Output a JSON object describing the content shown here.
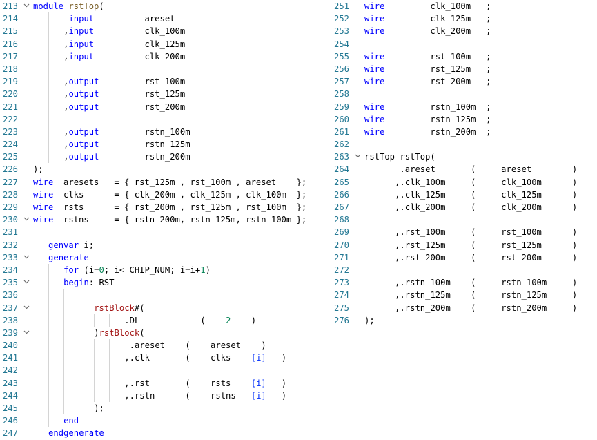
{
  "left_pane": {
    "lines": [
      {
        "n": "213",
        "fold": true,
        "indent": 0,
        "tokens": [
          [
            "keyword",
            "module "
          ],
          [
            "module",
            "rstTop"
          ],
          [
            "plain",
            "("
          ]
        ]
      },
      {
        "n": "214",
        "fold": false,
        "indent": 2,
        "tokens": [
          [
            "plain",
            " "
          ],
          [
            "keyword",
            "input"
          ],
          [
            "plain",
            "          areset"
          ]
        ]
      },
      {
        "n": "215",
        "fold": false,
        "indent": 2,
        "tokens": [
          [
            "plain",
            ","
          ],
          [
            "keyword",
            "input"
          ],
          [
            "plain",
            "          clk_100m"
          ]
        ]
      },
      {
        "n": "216",
        "fold": false,
        "indent": 2,
        "tokens": [
          [
            "plain",
            ","
          ],
          [
            "keyword",
            "input"
          ],
          [
            "plain",
            "          clk_125m"
          ]
        ]
      },
      {
        "n": "217",
        "fold": false,
        "indent": 2,
        "tokens": [
          [
            "plain",
            ","
          ],
          [
            "keyword",
            "input"
          ],
          [
            "plain",
            "          clk_200m"
          ]
        ]
      },
      {
        "n": "218",
        "fold": false,
        "indent": 2,
        "tokens": []
      },
      {
        "n": "219",
        "fold": false,
        "indent": 2,
        "tokens": [
          [
            "plain",
            ","
          ],
          [
            "keyword",
            "output"
          ],
          [
            "plain",
            "         rst_100m"
          ]
        ]
      },
      {
        "n": "220",
        "fold": false,
        "indent": 2,
        "tokens": [
          [
            "plain",
            ","
          ],
          [
            "keyword",
            "output"
          ],
          [
            "plain",
            "         rst_125m"
          ]
        ]
      },
      {
        "n": "221",
        "fold": false,
        "indent": 2,
        "tokens": [
          [
            "plain",
            ","
          ],
          [
            "keyword",
            "output"
          ],
          [
            "plain",
            "         rst_200m"
          ]
        ]
      },
      {
        "n": "222",
        "fold": false,
        "indent": 2,
        "tokens": []
      },
      {
        "n": "223",
        "fold": false,
        "indent": 2,
        "tokens": [
          [
            "plain",
            ","
          ],
          [
            "keyword",
            "output"
          ],
          [
            "plain",
            "         rstn_100m"
          ]
        ]
      },
      {
        "n": "224",
        "fold": false,
        "indent": 2,
        "tokens": [
          [
            "plain",
            ","
          ],
          [
            "keyword",
            "output"
          ],
          [
            "plain",
            "         rstn_125m"
          ]
        ]
      },
      {
        "n": "225",
        "fold": false,
        "indent": 2,
        "tokens": [
          [
            "plain",
            ","
          ],
          [
            "keyword",
            "output"
          ],
          [
            "plain",
            "         rstn_200m"
          ]
        ]
      },
      {
        "n": "226",
        "fold": false,
        "indent": 0,
        "tokens": [
          [
            "plain",
            ");"
          ]
        ]
      },
      {
        "n": "227",
        "fold": false,
        "indent": 0,
        "tokens": [
          [
            "keyword",
            "wire"
          ],
          [
            "plain",
            "  aresets   = { rst_125m , rst_100m , areset    };"
          ]
        ]
      },
      {
        "n": "228",
        "fold": false,
        "indent": 0,
        "tokens": [
          [
            "keyword",
            "wire"
          ],
          [
            "plain",
            "  clks      = { clk_200m , clk_125m , clk_100m  };"
          ]
        ]
      },
      {
        "n": "229",
        "fold": false,
        "indent": 0,
        "tokens": [
          [
            "keyword",
            "wire"
          ],
          [
            "plain",
            "  rsts      = { rst_200m , rst_125m , rst_100m  };"
          ]
        ]
      },
      {
        "n": "230",
        "fold": true,
        "indent": 0,
        "tokens": [
          [
            "keyword",
            "wire"
          ],
          [
            "plain",
            "  rstns     = { rstn_200m, rstn_125m, rstn_100m };"
          ]
        ]
      },
      {
        "n": "231",
        "fold": false,
        "indent": 1,
        "tokens": []
      },
      {
        "n": "232",
        "fold": false,
        "indent": 1,
        "tokens": [
          [
            "keyword",
            "genvar"
          ],
          [
            "plain",
            " i;"
          ]
        ]
      },
      {
        "n": "233",
        "fold": true,
        "indent": 1,
        "tokens": [
          [
            "keyword",
            "generate"
          ]
        ]
      },
      {
        "n": "234",
        "fold": false,
        "indent": 2,
        "tokens": [
          [
            "keyword",
            "for"
          ],
          [
            "plain",
            " (i="
          ],
          [
            "number",
            "0"
          ],
          [
            "plain",
            "; i< CHIP_NUM; i=i+"
          ],
          [
            "number",
            "1"
          ],
          [
            "plain",
            ")"
          ]
        ]
      },
      {
        "n": "235",
        "fold": true,
        "indent": 2,
        "tokens": [
          [
            "keyword",
            "begin"
          ],
          [
            "plain",
            ": RST"
          ]
        ]
      },
      {
        "n": "236",
        "fold": false,
        "indent": 3,
        "tokens": []
      },
      {
        "n": "237",
        "fold": true,
        "indent": 4,
        "tokens": [
          [
            "inst",
            "rstBlock"
          ],
          [
            "plain",
            "#("
          ]
        ]
      },
      {
        "n": "238",
        "fold": false,
        "indent": 6,
        "tokens": [
          [
            "plain",
            ".DL            (    "
          ],
          [
            "number",
            "2"
          ],
          [
            "plain",
            "    )"
          ]
        ]
      },
      {
        "n": "239",
        "fold": true,
        "indent": 4,
        "tokens": [
          [
            "plain",
            ")"
          ],
          [
            "inst",
            "rstBlock"
          ],
          [
            "plain",
            "("
          ]
        ]
      },
      {
        "n": "240",
        "fold": false,
        "indent": 6,
        "tokens": [
          [
            "plain",
            " .areset    (    areset    )"
          ]
        ]
      },
      {
        "n": "241",
        "fold": false,
        "indent": 6,
        "tokens": [
          [
            "plain",
            ",.clk       (    clks    "
          ],
          [
            "bracket",
            "[i]"
          ],
          [
            "plain",
            "   )"
          ]
        ]
      },
      {
        "n": "242",
        "fold": false,
        "indent": 6,
        "tokens": []
      },
      {
        "n": "243",
        "fold": false,
        "indent": 6,
        "tokens": [
          [
            "plain",
            ",.rst       (    rsts    "
          ],
          [
            "bracket",
            "[i]"
          ],
          [
            "plain",
            "   )"
          ]
        ]
      },
      {
        "n": "244",
        "fold": false,
        "indent": 6,
        "tokens": [
          [
            "plain",
            ",.rstn      (    rstns   "
          ],
          [
            "bracket",
            "[i]"
          ],
          [
            "plain",
            "   )"
          ]
        ]
      },
      {
        "n": "245",
        "fold": false,
        "indent": 4,
        "tokens": [
          [
            "plain",
            ");"
          ]
        ]
      },
      {
        "n": "246",
        "fold": false,
        "indent": 2,
        "tokens": [
          [
            "keyword",
            "end"
          ]
        ]
      },
      {
        "n": "247",
        "fold": false,
        "indent": 1,
        "tokens": [
          [
            "keyword",
            "endgenerate"
          ]
        ]
      }
    ]
  },
  "right_pane": {
    "lines": [
      {
        "n": "251",
        "fold": false,
        "indent": 0,
        "tokens": [
          [
            "keyword",
            "wire"
          ],
          [
            "plain",
            "         clk_100m   ;"
          ]
        ]
      },
      {
        "n": "252",
        "fold": false,
        "indent": 0,
        "tokens": [
          [
            "keyword",
            "wire"
          ],
          [
            "plain",
            "         clk_125m   ;"
          ]
        ]
      },
      {
        "n": "253",
        "fold": false,
        "indent": 0,
        "tokens": [
          [
            "keyword",
            "wire"
          ],
          [
            "plain",
            "         clk_200m   ;"
          ]
        ]
      },
      {
        "n": "254",
        "fold": false,
        "indent": 0,
        "tokens": []
      },
      {
        "n": "255",
        "fold": false,
        "indent": 0,
        "tokens": [
          [
            "keyword",
            "wire"
          ],
          [
            "plain",
            "         rst_100m   ;"
          ]
        ]
      },
      {
        "n": "256",
        "fold": false,
        "indent": 0,
        "tokens": [
          [
            "keyword",
            "wire"
          ],
          [
            "plain",
            "         rst_125m   ;"
          ]
        ]
      },
      {
        "n": "257",
        "fold": false,
        "indent": 0,
        "tokens": [
          [
            "keyword",
            "wire"
          ],
          [
            "plain",
            "         rst_200m   ;"
          ]
        ]
      },
      {
        "n": "258",
        "fold": false,
        "indent": 0,
        "tokens": []
      },
      {
        "n": "259",
        "fold": false,
        "indent": 0,
        "tokens": [
          [
            "keyword",
            "wire"
          ],
          [
            "plain",
            "         rstn_100m  ;"
          ]
        ]
      },
      {
        "n": "260",
        "fold": false,
        "indent": 0,
        "tokens": [
          [
            "keyword",
            "wire"
          ],
          [
            "plain",
            "         rstn_125m  ;"
          ]
        ]
      },
      {
        "n": "261",
        "fold": false,
        "indent": 0,
        "tokens": [
          [
            "keyword",
            "wire"
          ],
          [
            "plain",
            "         rstn_200m  ;"
          ]
        ]
      },
      {
        "n": "262",
        "fold": false,
        "indent": 0,
        "tokens": []
      },
      {
        "n": "263",
        "fold": true,
        "indent": 0,
        "tokens": [
          [
            "plain",
            "rstTop rstTop("
          ]
        ]
      },
      {
        "n": "264",
        "fold": false,
        "indent": 2,
        "tokens": [
          [
            "plain",
            " .areset       (     areset        )"
          ]
        ]
      },
      {
        "n": "265",
        "fold": false,
        "indent": 2,
        "tokens": [
          [
            "plain",
            ",.clk_100m     (     clk_100m      )"
          ]
        ]
      },
      {
        "n": "266",
        "fold": false,
        "indent": 2,
        "tokens": [
          [
            "plain",
            ",.clk_125m     (     clk_125m      )"
          ]
        ]
      },
      {
        "n": "267",
        "fold": false,
        "indent": 2,
        "tokens": [
          [
            "plain",
            ",.clk_200m     (     clk_200m      )"
          ]
        ]
      },
      {
        "n": "268",
        "fold": false,
        "indent": 2,
        "tokens": []
      },
      {
        "n": "269",
        "fold": false,
        "indent": 2,
        "tokens": [
          [
            "plain",
            ",.rst_100m     (     rst_100m      )"
          ]
        ]
      },
      {
        "n": "270",
        "fold": false,
        "indent": 2,
        "tokens": [
          [
            "plain",
            ",.rst_125m     (     rst_125m      )"
          ]
        ]
      },
      {
        "n": "271",
        "fold": false,
        "indent": 2,
        "tokens": [
          [
            "plain",
            ",.rst_200m     (     rst_200m      )"
          ]
        ]
      },
      {
        "n": "272",
        "fold": false,
        "indent": 2,
        "tokens": []
      },
      {
        "n": "273",
        "fold": false,
        "indent": 2,
        "tokens": [
          [
            "plain",
            ",.rstn_100m    (     rstn_100m     )"
          ]
        ]
      },
      {
        "n": "274",
        "fold": false,
        "indent": 2,
        "tokens": [
          [
            "plain",
            ",.rstn_125m    (     rstn_125m     )"
          ]
        ]
      },
      {
        "n": "275",
        "fold": false,
        "indent": 2,
        "tokens": [
          [
            "plain",
            ",.rstn_200m    (     rstn_200m     )"
          ]
        ]
      },
      {
        "n": "276",
        "fold": false,
        "indent": 0,
        "tokens": [
          [
            "plain",
            ");"
          ]
        ]
      }
    ]
  },
  "icons": {
    "fold": "chevron-down-icon"
  },
  "colors": {
    "keyword": "#0000ff",
    "module_name": "#795e26",
    "instance_name": "#a31515",
    "number": "#098658",
    "bracket": "#0431fa",
    "line_number": "#237893",
    "indent_guide": "#d4d4d4"
  }
}
